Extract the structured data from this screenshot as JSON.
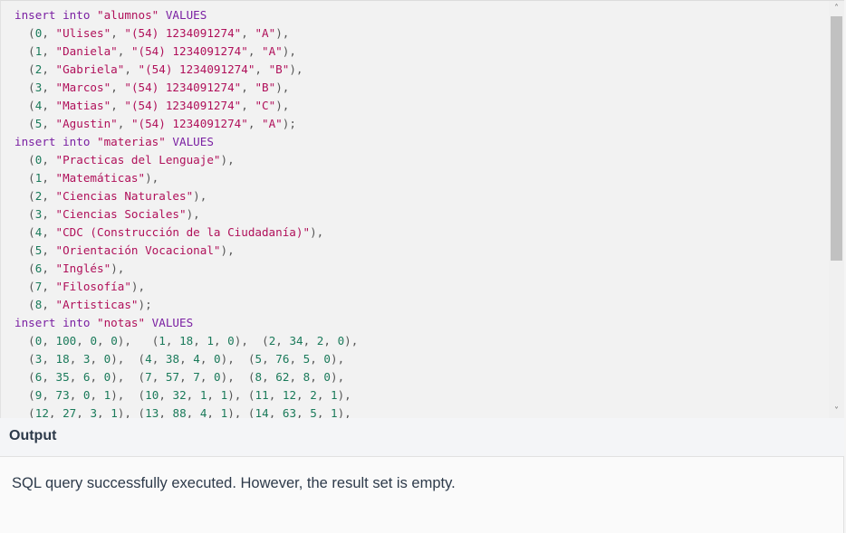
{
  "editor": {
    "lines": [
      [
        {
          "t": "insert into ",
          "c": "kw"
        },
        {
          "t": "\"alumnos\"",
          "c": "str"
        },
        {
          "t": " VALUES",
          "c": "kw"
        }
      ],
      [
        {
          "t": "  (",
          "c": "pun"
        },
        {
          "t": "0",
          "c": "num"
        },
        {
          "t": ", ",
          "c": "pun"
        },
        {
          "t": "\"Ulises\"",
          "c": "str"
        },
        {
          "t": ", ",
          "c": "pun"
        },
        {
          "t": "\"(54) 1234091274\"",
          "c": "str"
        },
        {
          "t": ", ",
          "c": "pun"
        },
        {
          "t": "\"A\"",
          "c": "str"
        },
        {
          "t": "),",
          "c": "pun"
        }
      ],
      [
        {
          "t": "  (",
          "c": "pun"
        },
        {
          "t": "1",
          "c": "num"
        },
        {
          "t": ", ",
          "c": "pun"
        },
        {
          "t": "\"Daniela\"",
          "c": "str"
        },
        {
          "t": ", ",
          "c": "pun"
        },
        {
          "t": "\"(54) 1234091274\"",
          "c": "str"
        },
        {
          "t": ", ",
          "c": "pun"
        },
        {
          "t": "\"A\"",
          "c": "str"
        },
        {
          "t": "),",
          "c": "pun"
        }
      ],
      [
        {
          "t": "  (",
          "c": "pun"
        },
        {
          "t": "2",
          "c": "num"
        },
        {
          "t": ", ",
          "c": "pun"
        },
        {
          "t": "\"Gabriela\"",
          "c": "str"
        },
        {
          "t": ", ",
          "c": "pun"
        },
        {
          "t": "\"(54) 1234091274\"",
          "c": "str"
        },
        {
          "t": ", ",
          "c": "pun"
        },
        {
          "t": "\"B\"",
          "c": "str"
        },
        {
          "t": "),",
          "c": "pun"
        }
      ],
      [
        {
          "t": "  (",
          "c": "pun"
        },
        {
          "t": "3",
          "c": "num"
        },
        {
          "t": ", ",
          "c": "pun"
        },
        {
          "t": "\"Marcos\"",
          "c": "str"
        },
        {
          "t": ", ",
          "c": "pun"
        },
        {
          "t": "\"(54) 1234091274\"",
          "c": "str"
        },
        {
          "t": ", ",
          "c": "pun"
        },
        {
          "t": "\"B\"",
          "c": "str"
        },
        {
          "t": "),",
          "c": "pun"
        }
      ],
      [
        {
          "t": "  (",
          "c": "pun"
        },
        {
          "t": "4",
          "c": "num"
        },
        {
          "t": ", ",
          "c": "pun"
        },
        {
          "t": "\"Matias\"",
          "c": "str"
        },
        {
          "t": ", ",
          "c": "pun"
        },
        {
          "t": "\"(54) 1234091274\"",
          "c": "str"
        },
        {
          "t": ", ",
          "c": "pun"
        },
        {
          "t": "\"C\"",
          "c": "str"
        },
        {
          "t": "),",
          "c": "pun"
        }
      ],
      [
        {
          "t": "  (",
          "c": "pun"
        },
        {
          "t": "5",
          "c": "num"
        },
        {
          "t": ", ",
          "c": "pun"
        },
        {
          "t": "\"Agustin\"",
          "c": "str"
        },
        {
          "t": ", ",
          "c": "pun"
        },
        {
          "t": "\"(54) 1234091274\"",
          "c": "str"
        },
        {
          "t": ", ",
          "c": "pun"
        },
        {
          "t": "\"A\"",
          "c": "str"
        },
        {
          "t": ");",
          "c": "pun"
        }
      ],
      [
        {
          "t": "insert into ",
          "c": "kw"
        },
        {
          "t": "\"materias\"",
          "c": "str"
        },
        {
          "t": " VALUES",
          "c": "kw"
        }
      ],
      [
        {
          "t": "  (",
          "c": "pun"
        },
        {
          "t": "0",
          "c": "num"
        },
        {
          "t": ", ",
          "c": "pun"
        },
        {
          "t": "\"Practicas del Lenguaje\"",
          "c": "str"
        },
        {
          "t": "),",
          "c": "pun"
        }
      ],
      [
        {
          "t": "  (",
          "c": "pun"
        },
        {
          "t": "1",
          "c": "num"
        },
        {
          "t": ", ",
          "c": "pun"
        },
        {
          "t": "\"Matemáticas\"",
          "c": "str"
        },
        {
          "t": "),",
          "c": "pun"
        }
      ],
      [
        {
          "t": "  (",
          "c": "pun"
        },
        {
          "t": "2",
          "c": "num"
        },
        {
          "t": ", ",
          "c": "pun"
        },
        {
          "t": "\"Ciencias Naturales\"",
          "c": "str"
        },
        {
          "t": "),",
          "c": "pun"
        }
      ],
      [
        {
          "t": "  (",
          "c": "pun"
        },
        {
          "t": "3",
          "c": "num"
        },
        {
          "t": ", ",
          "c": "pun"
        },
        {
          "t": "\"Ciencias Sociales\"",
          "c": "str"
        },
        {
          "t": "),",
          "c": "pun"
        }
      ],
      [
        {
          "t": "  (",
          "c": "pun"
        },
        {
          "t": "4",
          "c": "num"
        },
        {
          "t": ", ",
          "c": "pun"
        },
        {
          "t": "\"CDC (Construcción de la Ciudadanía)\"",
          "c": "str"
        },
        {
          "t": "),",
          "c": "pun"
        }
      ],
      [
        {
          "t": "  (",
          "c": "pun"
        },
        {
          "t": "5",
          "c": "num"
        },
        {
          "t": ", ",
          "c": "pun"
        },
        {
          "t": "\"Orientación Vocacional\"",
          "c": "str"
        },
        {
          "t": "),",
          "c": "pun"
        }
      ],
      [
        {
          "t": "  (",
          "c": "pun"
        },
        {
          "t": "6",
          "c": "num"
        },
        {
          "t": ", ",
          "c": "pun"
        },
        {
          "t": "\"Inglés\"",
          "c": "str"
        },
        {
          "t": "),",
          "c": "pun"
        }
      ],
      [
        {
          "t": "  (",
          "c": "pun"
        },
        {
          "t": "7",
          "c": "num"
        },
        {
          "t": ", ",
          "c": "pun"
        },
        {
          "t": "\"Filosofía\"",
          "c": "str"
        },
        {
          "t": "),",
          "c": "pun"
        }
      ],
      [
        {
          "t": "  (",
          "c": "pun"
        },
        {
          "t": "8",
          "c": "num"
        },
        {
          "t": ", ",
          "c": "pun"
        },
        {
          "t": "\"Artisticas\"",
          "c": "str"
        },
        {
          "t": ");",
          "c": "pun"
        }
      ],
      [
        {
          "t": "insert into ",
          "c": "kw"
        },
        {
          "t": "\"notas\"",
          "c": "str"
        },
        {
          "t": " VALUES",
          "c": "kw"
        }
      ],
      [
        {
          "t": "  (",
          "c": "pun"
        },
        {
          "t": "0",
          "c": "num"
        },
        {
          "t": ", ",
          "c": "pun"
        },
        {
          "t": "100",
          "c": "num"
        },
        {
          "t": ", ",
          "c": "pun"
        },
        {
          "t": "0",
          "c": "num"
        },
        {
          "t": ", ",
          "c": "pun"
        },
        {
          "t": "0",
          "c": "num"
        },
        {
          "t": "),   (",
          "c": "pun"
        },
        {
          "t": "1",
          "c": "num"
        },
        {
          "t": ", ",
          "c": "pun"
        },
        {
          "t": "18",
          "c": "num"
        },
        {
          "t": ", ",
          "c": "pun"
        },
        {
          "t": "1",
          "c": "num"
        },
        {
          "t": ", ",
          "c": "pun"
        },
        {
          "t": "0",
          "c": "num"
        },
        {
          "t": "),  (",
          "c": "pun"
        },
        {
          "t": "2",
          "c": "num"
        },
        {
          "t": ", ",
          "c": "pun"
        },
        {
          "t": "34",
          "c": "num"
        },
        {
          "t": ", ",
          "c": "pun"
        },
        {
          "t": "2",
          "c": "num"
        },
        {
          "t": ", ",
          "c": "pun"
        },
        {
          "t": "0",
          "c": "num"
        },
        {
          "t": "),",
          "c": "pun"
        }
      ],
      [
        {
          "t": "  (",
          "c": "pun"
        },
        {
          "t": "3",
          "c": "num"
        },
        {
          "t": ", ",
          "c": "pun"
        },
        {
          "t": "18",
          "c": "num"
        },
        {
          "t": ", ",
          "c": "pun"
        },
        {
          "t": "3",
          "c": "num"
        },
        {
          "t": ", ",
          "c": "pun"
        },
        {
          "t": "0",
          "c": "num"
        },
        {
          "t": "),  (",
          "c": "pun"
        },
        {
          "t": "4",
          "c": "num"
        },
        {
          "t": ", ",
          "c": "pun"
        },
        {
          "t": "38",
          "c": "num"
        },
        {
          "t": ", ",
          "c": "pun"
        },
        {
          "t": "4",
          "c": "num"
        },
        {
          "t": ", ",
          "c": "pun"
        },
        {
          "t": "0",
          "c": "num"
        },
        {
          "t": "),  (",
          "c": "pun"
        },
        {
          "t": "5",
          "c": "num"
        },
        {
          "t": ", ",
          "c": "pun"
        },
        {
          "t": "76",
          "c": "num"
        },
        {
          "t": ", ",
          "c": "pun"
        },
        {
          "t": "5",
          "c": "num"
        },
        {
          "t": ", ",
          "c": "pun"
        },
        {
          "t": "0",
          "c": "num"
        },
        {
          "t": "),",
          "c": "pun"
        }
      ],
      [
        {
          "t": "  (",
          "c": "pun"
        },
        {
          "t": "6",
          "c": "num"
        },
        {
          "t": ", ",
          "c": "pun"
        },
        {
          "t": "35",
          "c": "num"
        },
        {
          "t": ", ",
          "c": "pun"
        },
        {
          "t": "6",
          "c": "num"
        },
        {
          "t": ", ",
          "c": "pun"
        },
        {
          "t": "0",
          "c": "num"
        },
        {
          "t": "),  (",
          "c": "pun"
        },
        {
          "t": "7",
          "c": "num"
        },
        {
          "t": ", ",
          "c": "pun"
        },
        {
          "t": "57",
          "c": "num"
        },
        {
          "t": ", ",
          "c": "pun"
        },
        {
          "t": "7",
          "c": "num"
        },
        {
          "t": ", ",
          "c": "pun"
        },
        {
          "t": "0",
          "c": "num"
        },
        {
          "t": "),  (",
          "c": "pun"
        },
        {
          "t": "8",
          "c": "num"
        },
        {
          "t": ", ",
          "c": "pun"
        },
        {
          "t": "62",
          "c": "num"
        },
        {
          "t": ", ",
          "c": "pun"
        },
        {
          "t": "8",
          "c": "num"
        },
        {
          "t": ", ",
          "c": "pun"
        },
        {
          "t": "0",
          "c": "num"
        },
        {
          "t": "),",
          "c": "pun"
        }
      ],
      [
        {
          "t": "  (",
          "c": "pun"
        },
        {
          "t": "9",
          "c": "num"
        },
        {
          "t": ", ",
          "c": "pun"
        },
        {
          "t": "73",
          "c": "num"
        },
        {
          "t": ", ",
          "c": "pun"
        },
        {
          "t": "0",
          "c": "num"
        },
        {
          "t": ", ",
          "c": "pun"
        },
        {
          "t": "1",
          "c": "num"
        },
        {
          "t": "),  (",
          "c": "pun"
        },
        {
          "t": "10",
          "c": "num"
        },
        {
          "t": ", ",
          "c": "pun"
        },
        {
          "t": "32",
          "c": "num"
        },
        {
          "t": ", ",
          "c": "pun"
        },
        {
          "t": "1",
          "c": "num"
        },
        {
          "t": ", ",
          "c": "pun"
        },
        {
          "t": "1",
          "c": "num"
        },
        {
          "t": "), (",
          "c": "pun"
        },
        {
          "t": "11",
          "c": "num"
        },
        {
          "t": ", ",
          "c": "pun"
        },
        {
          "t": "12",
          "c": "num"
        },
        {
          "t": ", ",
          "c": "pun"
        },
        {
          "t": "2",
          "c": "num"
        },
        {
          "t": ", ",
          "c": "pun"
        },
        {
          "t": "1",
          "c": "num"
        },
        {
          "t": "),",
          "c": "pun"
        }
      ],
      [
        {
          "t": "  (",
          "c": "pun"
        },
        {
          "t": "12",
          "c": "num"
        },
        {
          "t": ", ",
          "c": "pun"
        },
        {
          "t": "27",
          "c": "num"
        },
        {
          "t": ", ",
          "c": "pun"
        },
        {
          "t": "3",
          "c": "num"
        },
        {
          "t": ", ",
          "c": "pun"
        },
        {
          "t": "1",
          "c": "num"
        },
        {
          "t": "), (",
          "c": "pun"
        },
        {
          "t": "13",
          "c": "num"
        },
        {
          "t": ", ",
          "c": "pun"
        },
        {
          "t": "88",
          "c": "num"
        },
        {
          "t": ", ",
          "c": "pun"
        },
        {
          "t": "4",
          "c": "num"
        },
        {
          "t": ", ",
          "c": "pun"
        },
        {
          "t": "1",
          "c": "num"
        },
        {
          "t": "), (",
          "c": "pun"
        },
        {
          "t": "14",
          "c": "num"
        },
        {
          "t": ", ",
          "c": "pun"
        },
        {
          "t": "63",
          "c": "num"
        },
        {
          "t": ", ",
          "c": "pun"
        },
        {
          "t": "5",
          "c": "num"
        },
        {
          "t": ", ",
          "c": "pun"
        },
        {
          "t": "1",
          "c": "num"
        },
        {
          "t": "),",
          "c": "pun"
        }
      ]
    ]
  },
  "scrollbar": {
    "up_icon": "chevron-up-icon",
    "down_icon": "chevron-down-icon",
    "up_glyph": "˄",
    "down_glyph": "˅"
  },
  "output": {
    "title": "Output",
    "message": "SQL query successfully executed. However, the result set is empty."
  },
  "colors": {
    "keyword": "#7a1fa2",
    "string": "#b0105a",
    "number": "#1a7a5a",
    "text": "#2d3a4a"
  }
}
